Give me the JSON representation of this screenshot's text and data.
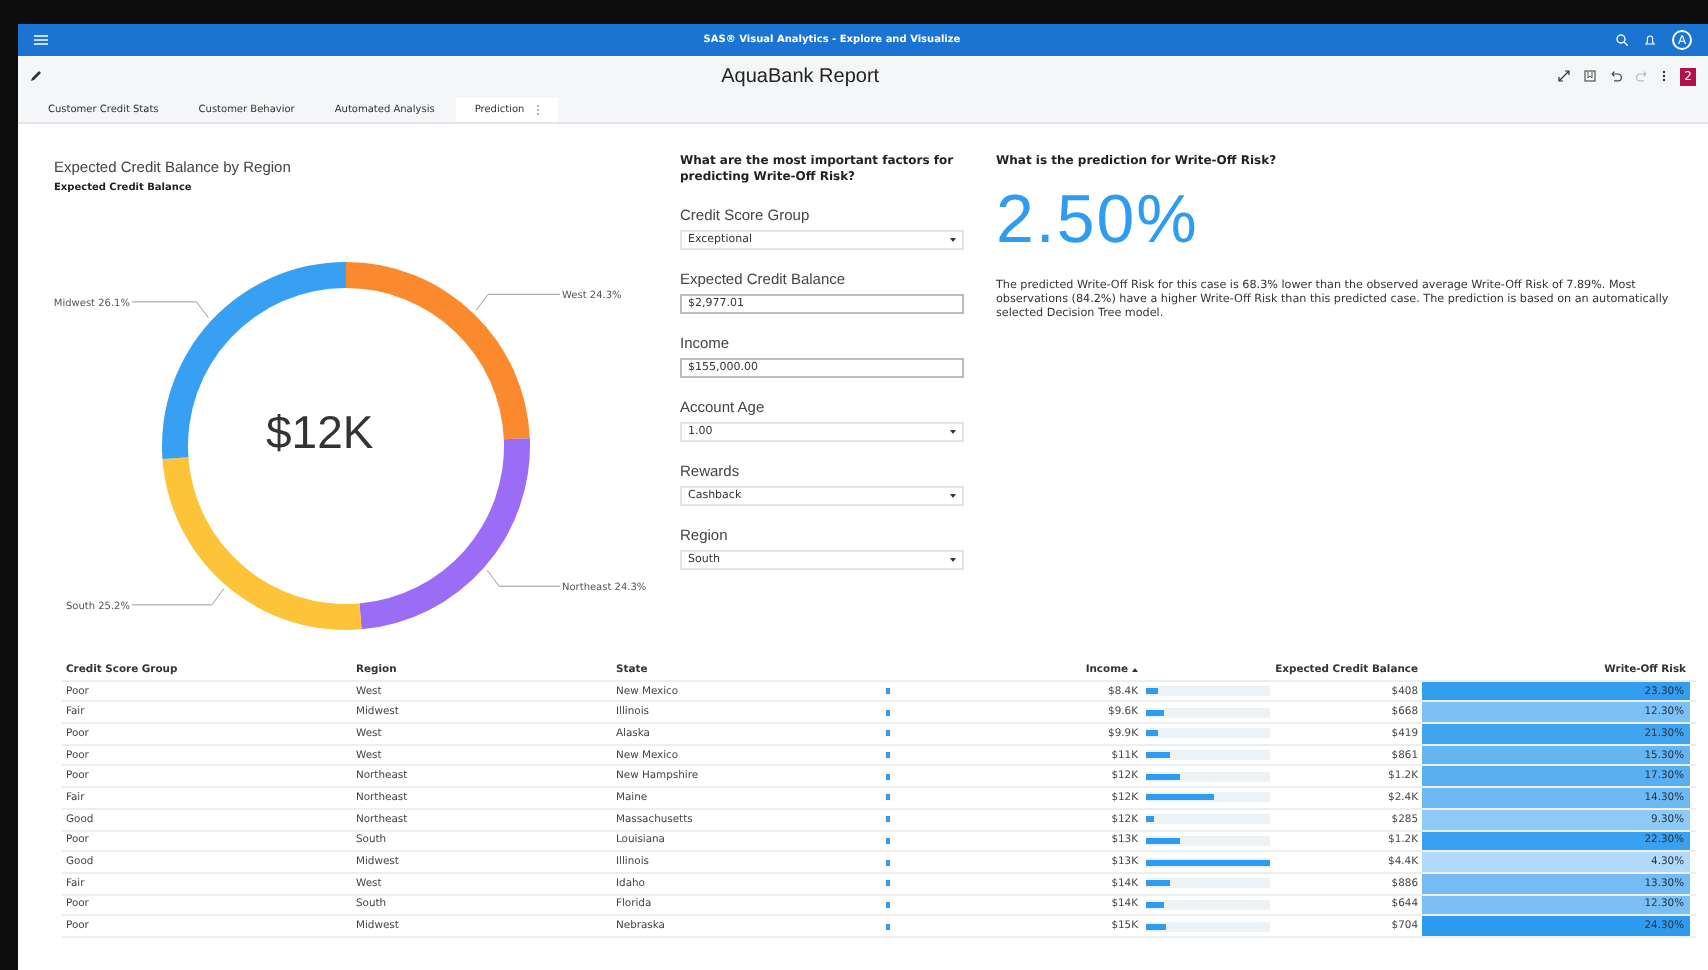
{
  "app_bar": {
    "title": "SAS® Visual Analytics - Explore and Visualize",
    "avatar": "A"
  },
  "report_bar": {
    "title": "AquaBank Report",
    "badge": "2"
  },
  "tabs": [
    {
      "label": "Customer Credit Stats",
      "selected": false
    },
    {
      "label": "Customer Behavior",
      "selected": false
    },
    {
      "label": "Automated Analysis",
      "selected": false
    },
    {
      "label": "Prediction",
      "selected": true
    }
  ],
  "donut_panel": {
    "title": "Expected Credit Balance by Region",
    "subtitle": "Expected Credit Balance",
    "center": "$12K",
    "chart_data": {
      "type": "donut",
      "categories": [
        "West",
        "Northeast",
        "South",
        "Midwest"
      ],
      "values": [
        24.3,
        24.3,
        25.2,
        26.1
      ],
      "colors": [
        "#fb8a2e",
        "#9b6cf5",
        "#fdc43a",
        "#37a0f3"
      ],
      "value_labels": [
        "24.3%",
        "24.3%",
        "25.2%",
        "26.1%"
      ]
    }
  },
  "factors": {
    "title": "What are the most important factors for predicting Write-Off Risk?",
    "fields": [
      {
        "label": "Credit Score Group",
        "kind": "select",
        "value": "Exceptional"
      },
      {
        "label": "Expected Credit Balance",
        "kind": "input",
        "value": "$2,977.01"
      },
      {
        "label": "Income",
        "kind": "input",
        "value": "$155,000.00"
      },
      {
        "label": "Account Age",
        "kind": "select",
        "value": "1.00"
      },
      {
        "label": "Rewards",
        "kind": "select",
        "value": "Cashback"
      },
      {
        "label": "Region",
        "kind": "select",
        "value": "South"
      }
    ]
  },
  "prediction": {
    "title": "What is the prediction for Write-Off Risk?",
    "value": "2.50%",
    "text": "The predicted Write-Off Risk for this case is 68.3% lower than the observed average Write-Off Risk of 7.89%. Most observations (84.2%) have a higher Write-Off Risk than this predicted case. The prediction is based on an automatically selected Decision Tree model."
  },
  "table": {
    "columns": [
      "Credit Score Group",
      "Region",
      "State",
      "Income",
      "Expected Credit Balance",
      "Write-Off Risk"
    ],
    "rows": [
      {
        "group": "Poor",
        "region": "West",
        "state": "New Mexico",
        "income": "$8.4K",
        "balance_bar": {
          "level": 0.09
        },
        "balance": "$408",
        "risk": {
          "text": "23.30%",
          "color": "#339df0"
        }
      },
      {
        "group": "Fair",
        "region": "Midwest",
        "state": "Illinois",
        "income": "$9.6K",
        "balance_bar": {
          "level": 0.15
        },
        "balance": "$668",
        "risk": {
          "text": "12.30%",
          "color": "#7cc0f5"
        }
      },
      {
        "group": "Poor",
        "region": "West",
        "state": "Alaska",
        "income": "$9.9K",
        "balance_bar": {
          "level": 0.1
        },
        "balance": "$419",
        "risk": {
          "text": "21.30%",
          "color": "#41a4f1"
        }
      },
      {
        "group": "Poor",
        "region": "West",
        "state": "New Mexico",
        "income": "$11K",
        "balance_bar": {
          "level": 0.2
        },
        "balance": "$861",
        "risk": {
          "text": "15.30%",
          "color": "#66b5f3"
        }
      },
      {
        "group": "Poor",
        "region": "Northeast",
        "state": "New Hampshire",
        "income": "$12K",
        "balance_bar": {
          "level": 0.27
        },
        "balance": "$1.2K",
        "risk": {
          "text": "17.30%",
          "color": "#58aff2"
        }
      },
      {
        "group": "Fair",
        "region": "Northeast",
        "state": "Maine",
        "income": "$12K",
        "balance_bar": {
          "level": 0.55
        },
        "balance": "$2.4K",
        "risk": {
          "text": "14.30%",
          "color": "#6db9f4"
        }
      },
      {
        "group": "Good",
        "region": "Northeast",
        "state": "Massachusetts",
        "income": "$12K",
        "balance_bar": {
          "level": 0.065
        },
        "balance": "$285",
        "risk": {
          "text": "9.30%",
          "color": "#8fc9f6"
        }
      },
      {
        "group": "Poor",
        "region": "South",
        "state": "Louisiana",
        "income": "$13K",
        "balance_bar": {
          "level": 0.27
        },
        "balance": "$1.2K",
        "risk": {
          "text": "22.30%",
          "color": "#3aa0f0"
        }
      },
      {
        "group": "Good",
        "region": "Midwest",
        "state": "Illinois",
        "income": "$13K",
        "balance_bar": {
          "level": 1.0
        },
        "balance": "$4.4K",
        "risk": {
          "text": "4.30%",
          "color": "#b1d9f9"
        }
      },
      {
        "group": "Fair",
        "region": "West",
        "state": "Idaho",
        "income": "$14K",
        "balance_bar": {
          "level": 0.2
        },
        "balance": "$886",
        "risk": {
          "text": "13.30%",
          "color": "#75bcf4"
        }
      },
      {
        "group": "Poor",
        "region": "South",
        "state": "Florida",
        "income": "$14K",
        "balance_bar": {
          "level": 0.15
        },
        "balance": "$644",
        "risk": {
          "text": "12.30%",
          "color": "#7bc0f5"
        }
      },
      {
        "group": "Poor",
        "region": "Midwest",
        "state": "Nebraska",
        "income": "$15K",
        "balance_bar": {
          "level": 0.16
        },
        "balance": "$704",
        "risk": {
          "text": "24.30%",
          "color": "#2e9bef"
        }
      }
    ]
  }
}
